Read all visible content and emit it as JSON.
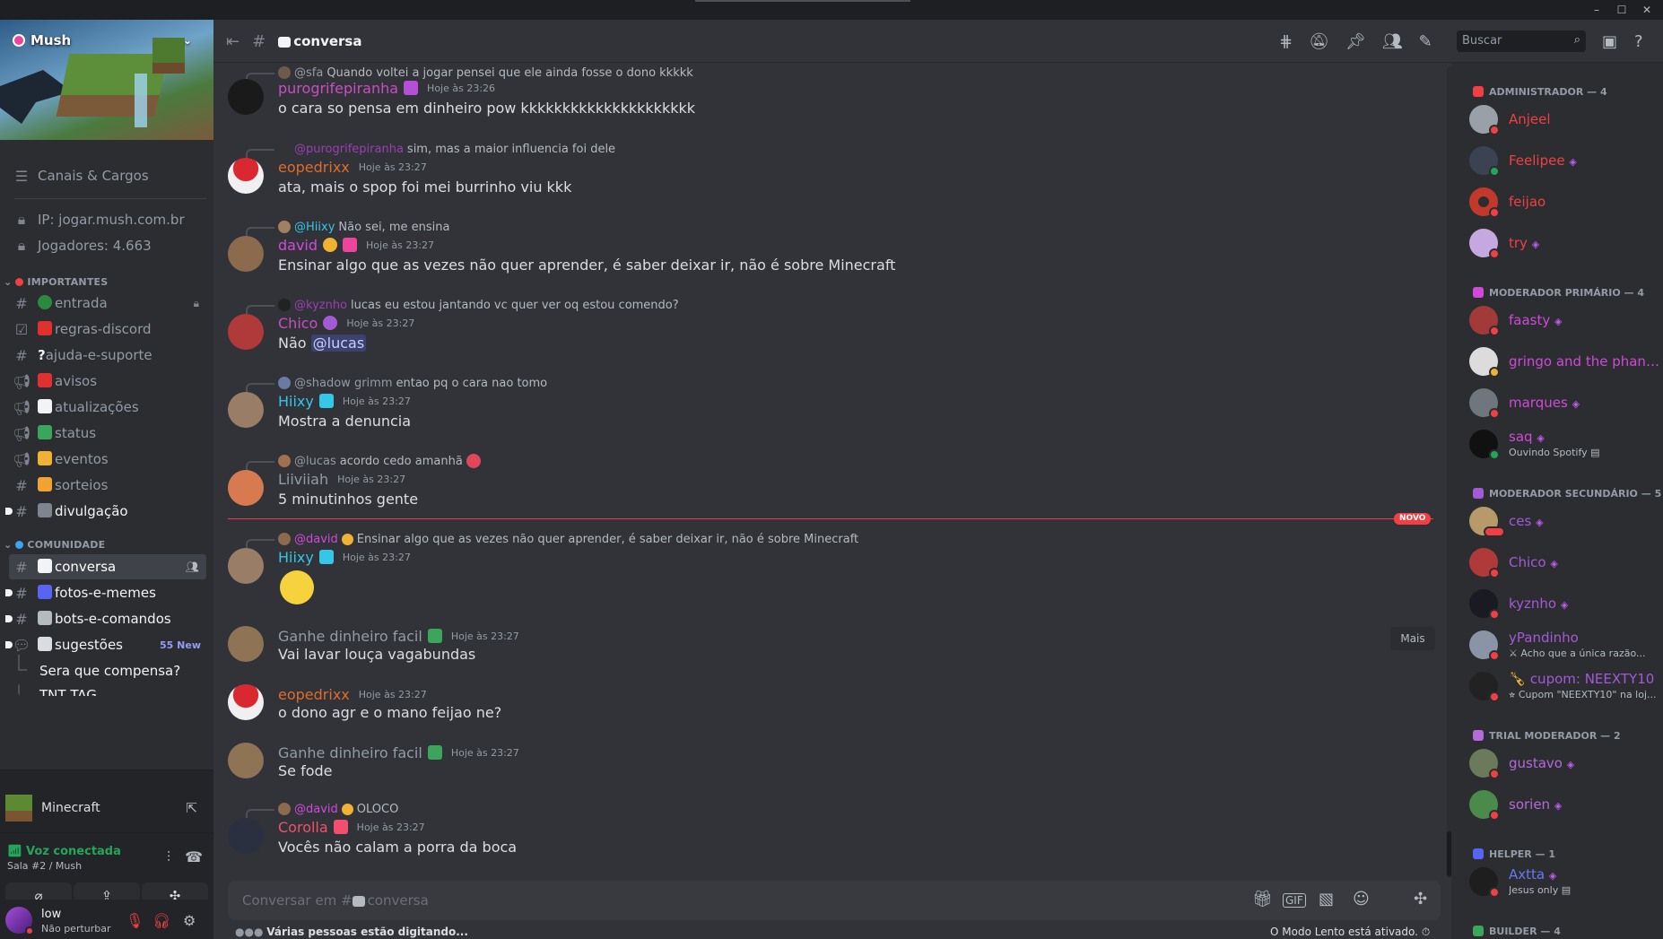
{
  "window": {
    "min": "–",
    "max": "☐",
    "close": "✕"
  },
  "server": {
    "name": "Mush"
  },
  "sidebar": {
    "channels_roles": "Canais & Cargos",
    "ip": "IP: jogar.mush.com.br",
    "players": "Jogadores: 4.663",
    "cat_importantes": "IMPORTANTES",
    "cat_comunidade": "COMUNIDADE",
    "channels": [
      {
        "name": "entrada"
      },
      {
        "name": "regras-discord"
      },
      {
        "name": "ajuda-e-suporte"
      },
      {
        "name": "avisos"
      },
      {
        "name": "atualizações"
      },
      {
        "name": "status"
      },
      {
        "name": "eventos"
      },
      {
        "name": "sorteios"
      },
      {
        "name": "divulgação"
      },
      {
        "name": "conversa"
      },
      {
        "name": "fotos-e-memes"
      },
      {
        "name": "bots-e-comandos"
      },
      {
        "name": "sugestões",
        "badge": "55 New"
      },
      {
        "name": "Sera que compensa?"
      },
      {
        "name": "TNT TAG"
      }
    ],
    "help_mark": "?"
  },
  "voice": {
    "game": "Minecraft",
    "status": "Voz conectada",
    "room": "Sala #2 / Mush"
  },
  "user": {
    "name": "low",
    "status": "Não perturbar"
  },
  "header": {
    "channel": "conversa",
    "search_placeholder": "Buscar"
  },
  "messages": [
    {
      "reply_mention": "@sfa",
      "reply_text": "Quando voltei a jogar pensei que ele ainda fosse o dono kkkkk",
      "user": "purogrifepiranha",
      "time": "Hoje às 23:26",
      "text": "o cara so pensa em dinheiro pow kkkkkkkkkkkkkkkkkkkkk"
    },
    {
      "reply_mention": "@purogrifepiranha",
      "reply_text": "sim, mas a maior influencia foi dele",
      "user": "eopedrixx",
      "time": "Hoje às 23:27",
      "text": "ata, mais o spop foi mei burrinho viu kkk"
    },
    {
      "reply_mention": "@Hiixy",
      "reply_text": "Não sei, me ensina",
      "user": "david",
      "time": "Hoje às 23:27",
      "text": "Ensinar algo que as vezes não quer aprender, é saber deixar ir, não é sobre Minecraft"
    },
    {
      "reply_mention": "@kyznho",
      "reply_text": "lucas eu estou jantando vc quer ver oq estou comendo?",
      "user": "Chico",
      "time": "Hoje às 23:27",
      "text": "Não",
      "mention": "@lucas"
    },
    {
      "reply_mention": "@shadow grimm",
      "reply_text": "entao pq o cara nao tomo",
      "user": "Hiixy",
      "time": "Hoje às 23:27",
      "text": "Mostra a denuncia"
    },
    {
      "reply_mention": "@lucas",
      "reply_text": "acordo cedo amanhã",
      "user": "Liiviiah",
      "time": "Hoje às 23:27",
      "text": "5 minutinhos gente"
    },
    {
      "reply_mention": "@david",
      "reply_text": "Ensinar algo que as vezes não quer aprender, é saber deixar ir, não é sobre Minecraft",
      "user": "Hiixy",
      "time": "Hoje às 23:27",
      "text": ""
    },
    {
      "user": "Ganhe dinheiro facil",
      "time": "Hoje às 23:27",
      "text": "Vai lavar louça vagabundas"
    },
    {
      "user": "eopedrixx",
      "time": "Hoje às 23:27",
      "text": "o dono agr e o mano feijao ne?"
    },
    {
      "user": "Ganhe dinheiro facil",
      "time": "Hoje às 23:27",
      "text": "Se fode"
    },
    {
      "reply_mention": "@david",
      "reply_text": "OLOCO",
      "user": "Corolla",
      "time": "Hoje às 23:27",
      "text": "Vocês não calam a porra da boca"
    }
  ],
  "new_tag": "NOVO",
  "more_label": "Mais",
  "composer": {
    "placeholder_prefix": "Conversar em #",
    "placeholder_channel": "conversa"
  },
  "typing": {
    "text": "Várias pessoas estão digitando..."
  },
  "slowmode": "O Modo Lento está ativado.",
  "members": {
    "cats": [
      "ADMINISTRADOR — 4",
      "MODERADOR PRIMÁRIO — 4",
      "MODERADOR SECUNDÁRIO — 5",
      "TRIAL MODERADOR — 2",
      "HELPER — 1",
      "BUILDER — 4"
    ],
    "list": [
      {
        "name": "Anjeel"
      },
      {
        "name": "Feelipee"
      },
      {
        "name": "feijao"
      },
      {
        "name": "try"
      },
      {
        "name": "faasty"
      },
      {
        "name": "gringo and the phantom..."
      },
      {
        "name": "marques"
      },
      {
        "name": "saq",
        "status": "Ouvindo Spotify"
      },
      {
        "name": "ces"
      },
      {
        "name": "Chico"
      },
      {
        "name": "kyznho"
      },
      {
        "name": "yPandinho",
        "status": "Acho que a única razão..."
      },
      {
        "name": "cupom: NEEXTY10",
        "status": "Cupom \"NEEXTY10\" na loj..."
      },
      {
        "name": "gustavo"
      },
      {
        "name": "sorien"
      },
      {
        "name": "Axtta",
        "status": "Jesus only"
      }
    ]
  }
}
